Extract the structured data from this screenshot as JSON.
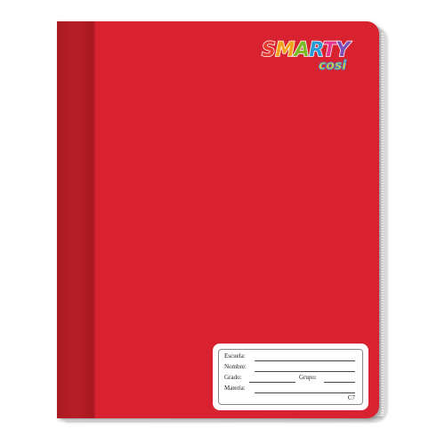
{
  "brand": {
    "name_letters": [
      "S",
      "M",
      "A",
      "R",
      "T",
      "Y"
    ],
    "name_colors": [
      "#e53a2e",
      "#f5a21b",
      "#7dbb2a",
      "#2a9ad6",
      "#e6358c",
      "#7b4fb5"
    ],
    "sub": "cosi"
  },
  "label": {
    "escuela": "Escuela:",
    "nombre": "Nombre:",
    "grado": "Grado:",
    "grupo": "Grupo:",
    "materia": "Materia:",
    "code": "C7"
  },
  "colors": {
    "cover": "#d8222f",
    "spine": "#b01c25"
  }
}
